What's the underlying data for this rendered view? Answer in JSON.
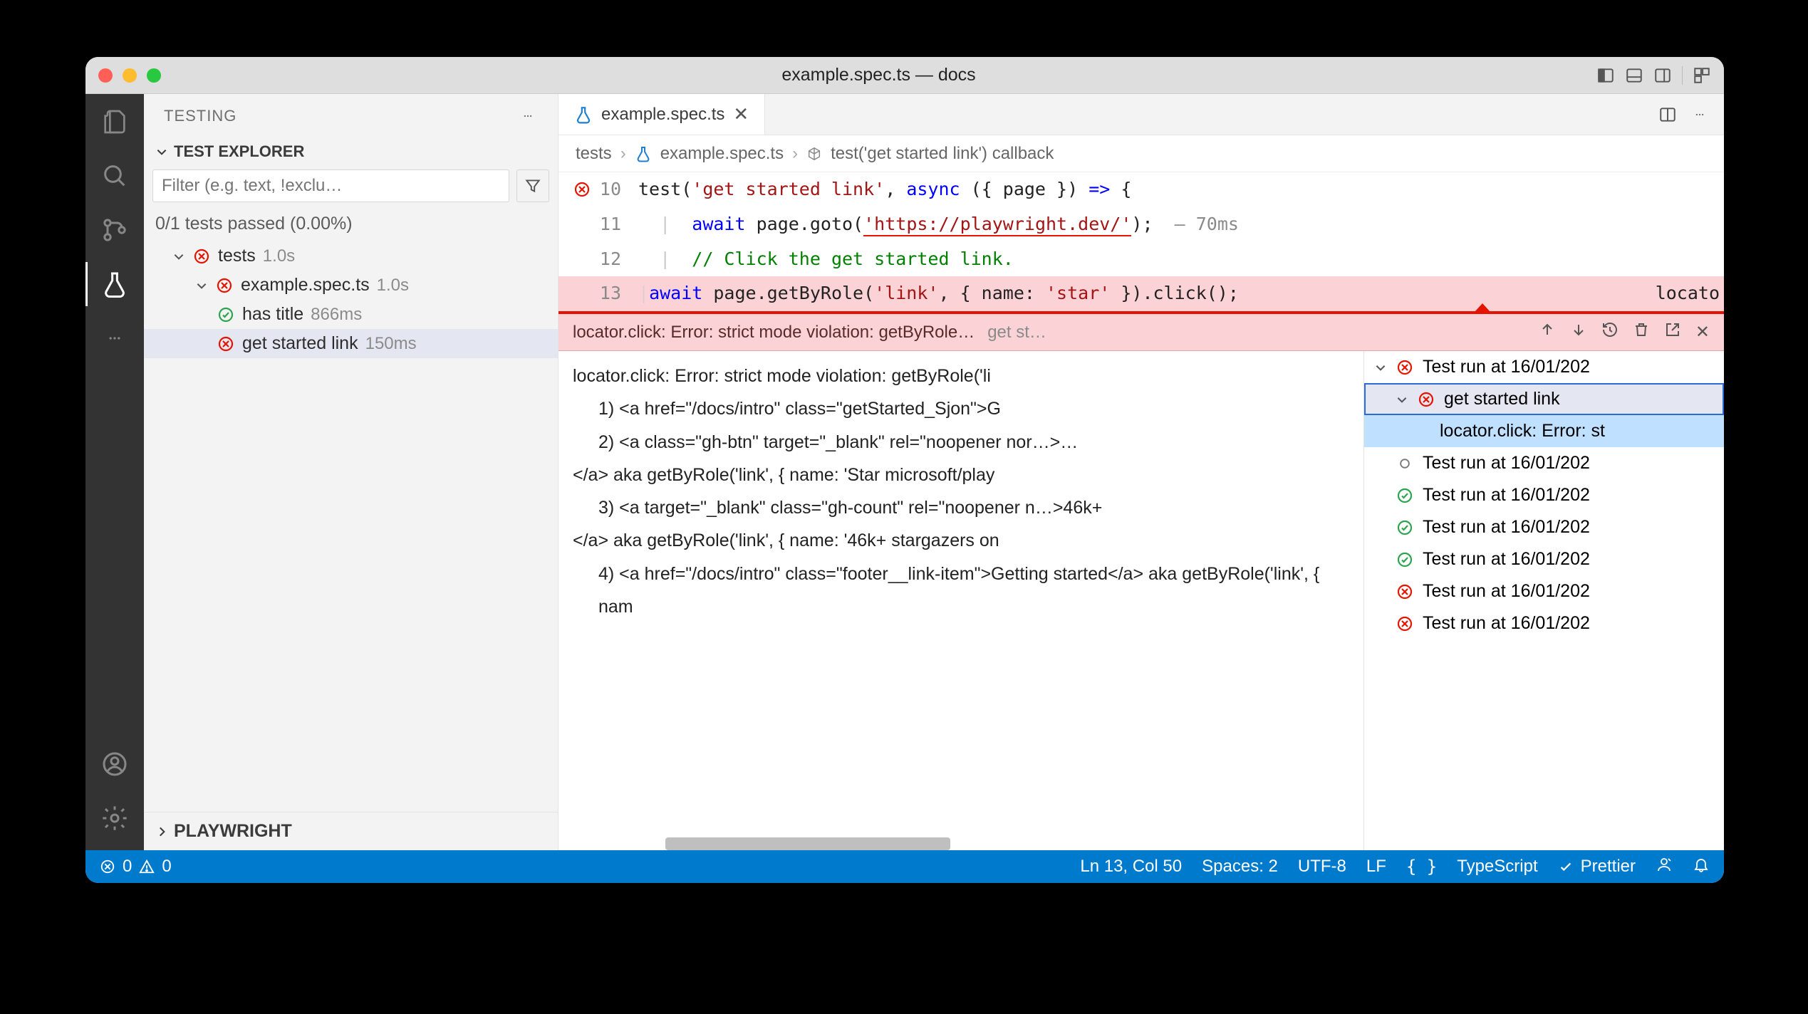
{
  "window": {
    "title": "example.spec.ts — docs"
  },
  "sidebar": {
    "heading": "TESTING",
    "section": "TEST EXPLORER",
    "filter_placeholder": "Filter (e.g. text, !exclu…",
    "tests_passed": "0/1 tests passed (0.00%)",
    "tree": {
      "root": {
        "label": "tests",
        "time": "1.0s"
      },
      "file": {
        "label": "example.spec.ts",
        "time": "1.0s"
      },
      "t1": {
        "label": "has title",
        "time": "866ms"
      },
      "t2": {
        "label": "get started link",
        "time": "150ms"
      }
    },
    "bottom": "PLAYWRIGHT"
  },
  "tab": {
    "label": "example.spec.ts"
  },
  "breadcrumb": {
    "p1": "tests",
    "p2": "example.spec.ts",
    "p3": "test('get started link') callback"
  },
  "code": {
    "l10": {
      "num": "10",
      "a": "test(",
      "b": "'get started link'",
      "c": ", ",
      "d": "async",
      "e": " ({ page }) ",
      "f": "=>",
      "g": " {"
    },
    "l11": {
      "num": "11",
      "a": "await",
      "b": " page.goto(",
      "c": "'https://playwright.dev/'",
      "d": ");",
      "note": "— 70ms"
    },
    "l12": {
      "num": "12",
      "a": "// Click the get started link."
    },
    "l13": {
      "num": "13",
      "a": "await",
      "b": " page.getByRole(",
      "c": "'link'",
      "d": ", { name: ",
      "e": "'star'",
      "f": " }).click();",
      "right": "locato"
    }
  },
  "peek": {
    "msg": "locator.click: Error: strict mode violation: getByRole…",
    "hint": "get st…"
  },
  "error_detail": {
    "l0": "locator.click: Error: strict mode violation: getByRole('li",
    "l1": "1) <a href=\"/docs/intro\" class=\"getStarted_Sjon\">G",
    "l2": "2) <a class=\"gh-btn\" target=\"_blank\" rel=\"noopener nor…>…",
    "l3": "</a> aka getByRole('link', { name: 'Star microsoft/play",
    "l4": "3) <a target=\"_blank\" class=\"gh-count\" rel=\"noopener n…>46k+",
    "l5": "</a> aka getByRole('link', { name: '46k+ stargazers on",
    "l6": "4) <a href=\"/docs/intro\" class=\"footer__link-item\">Getting started</a> aka getByRole('link', { nam"
  },
  "runs": {
    "r0": "Test run at 16/01/202",
    "r1": "get started link",
    "r2": "locator.click: Error: st",
    "r3": "Test run at 16/01/202",
    "r4": "Test run at 16/01/202",
    "r5": "Test run at 16/01/202",
    "r6": "Test run at 16/01/202",
    "r7": "Test run at 16/01/202",
    "r8": "Test run at 16/01/202"
  },
  "status": {
    "errors": "0",
    "warnings": "0",
    "pos": "Ln 13, Col 50",
    "spaces": "Spaces: 2",
    "enc": "UTF-8",
    "eol": "LF",
    "lang": "TypeScript",
    "fmt": "Prettier"
  }
}
